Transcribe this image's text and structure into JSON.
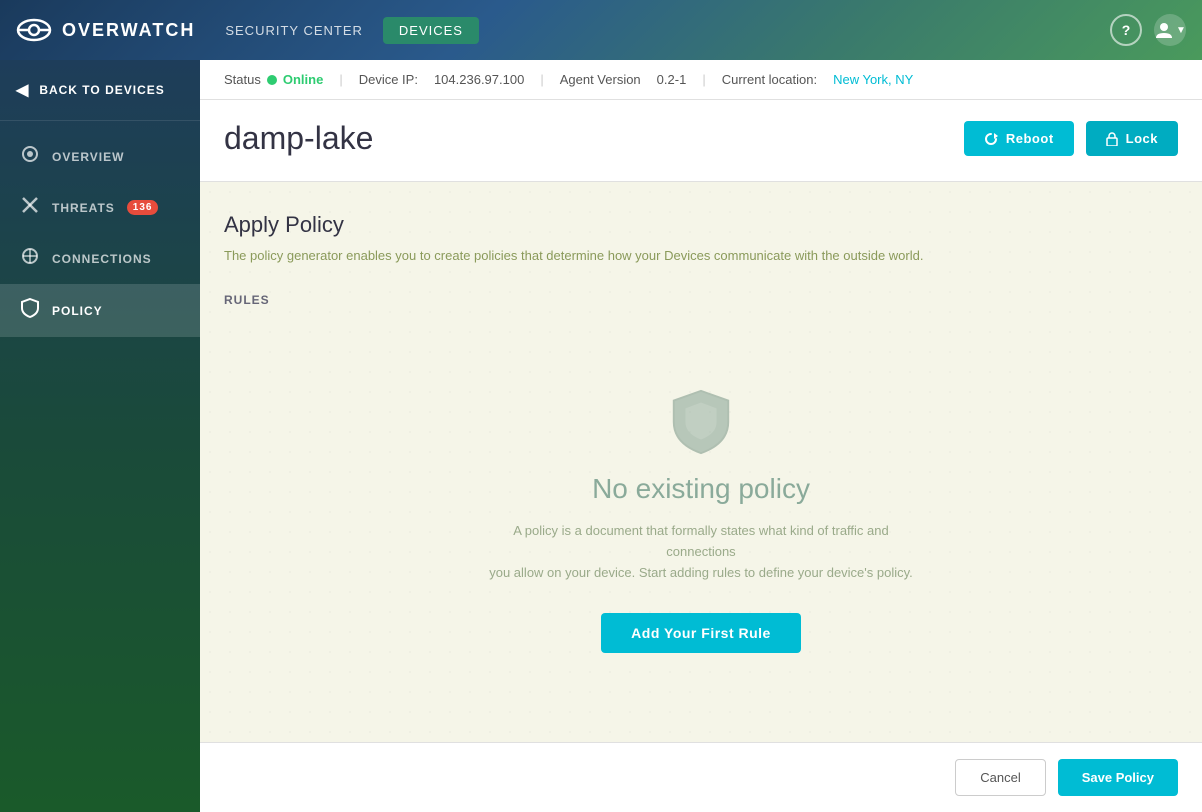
{
  "app": {
    "name": "OVERWATCH"
  },
  "topnav": {
    "security_center_label": "SECURITY CENTER",
    "devices_label": "DEVICES",
    "help_label": "?",
    "user_label": "👤"
  },
  "sidebar": {
    "back_label": "BACK TO DEVICES",
    "items": [
      {
        "id": "overview",
        "label": "OVERVIEW",
        "icon": "⊙",
        "active": false,
        "badge": null
      },
      {
        "id": "threats",
        "label": "THREATS",
        "icon": "✖",
        "active": false,
        "badge": "136"
      },
      {
        "id": "connections",
        "label": "CONNECTIONS",
        "icon": "⊕",
        "active": false,
        "badge": null
      },
      {
        "id": "policy",
        "label": "POLICY",
        "icon": "🛡",
        "active": true,
        "badge": null
      }
    ]
  },
  "status_bar": {
    "status_label": "Status",
    "status_value": "Online",
    "device_ip_label": "Device IP:",
    "device_ip_value": "104.236.97.100",
    "agent_version_label": "Agent Version",
    "agent_version_value": "0.2-1",
    "current_location_label": "Current location:",
    "current_location_value": "New York, NY"
  },
  "device_header": {
    "device_name": "damp-lake",
    "reboot_label": "Reboot",
    "lock_label": "Lock"
  },
  "policy": {
    "title": "Apply Policy",
    "description": "The policy generator enables you to create policies that determine how your Devices communicate with the outside world.",
    "rules_label": "RULES",
    "empty_title": "No existing policy",
    "empty_desc_line1": "A policy is a document that formally states what kind of traffic and connections",
    "empty_desc_line2": "you allow on your device. Start adding rules to define your device's policy.",
    "add_rule_label": "Add Your First Rule"
  },
  "footer": {
    "cancel_label": "Cancel",
    "save_label": "Save Policy"
  }
}
